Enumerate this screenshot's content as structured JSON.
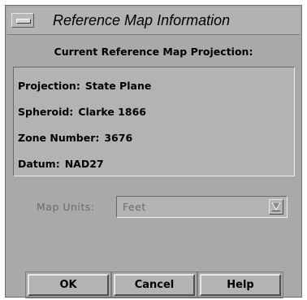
{
  "window": {
    "title": "Reference Map Information"
  },
  "section": {
    "heading": "Current Reference Map Projection:"
  },
  "info": [
    {
      "label": "Projection:",
      "value": "State Plane"
    },
    {
      "label": "Spheroid:",
      "value": "Clarke 1866"
    },
    {
      "label": "Zone Number:",
      "value": "3676"
    },
    {
      "label": "Datum:",
      "value": "NAD27"
    }
  ],
  "units": {
    "label": "Map Units:",
    "value": "Feet",
    "disabled": true
  },
  "buttons": {
    "ok": "OK",
    "cancel": "Cancel",
    "help": "Help"
  },
  "icons": {
    "window_menu": "window-menu-icon",
    "dropdown": "dropdown-arrow-icon"
  },
  "colors": {
    "dialog_bg": "#a9a9a9",
    "panel_bg": "#b3b3b3",
    "disabled_text": "#6b6b6b"
  }
}
